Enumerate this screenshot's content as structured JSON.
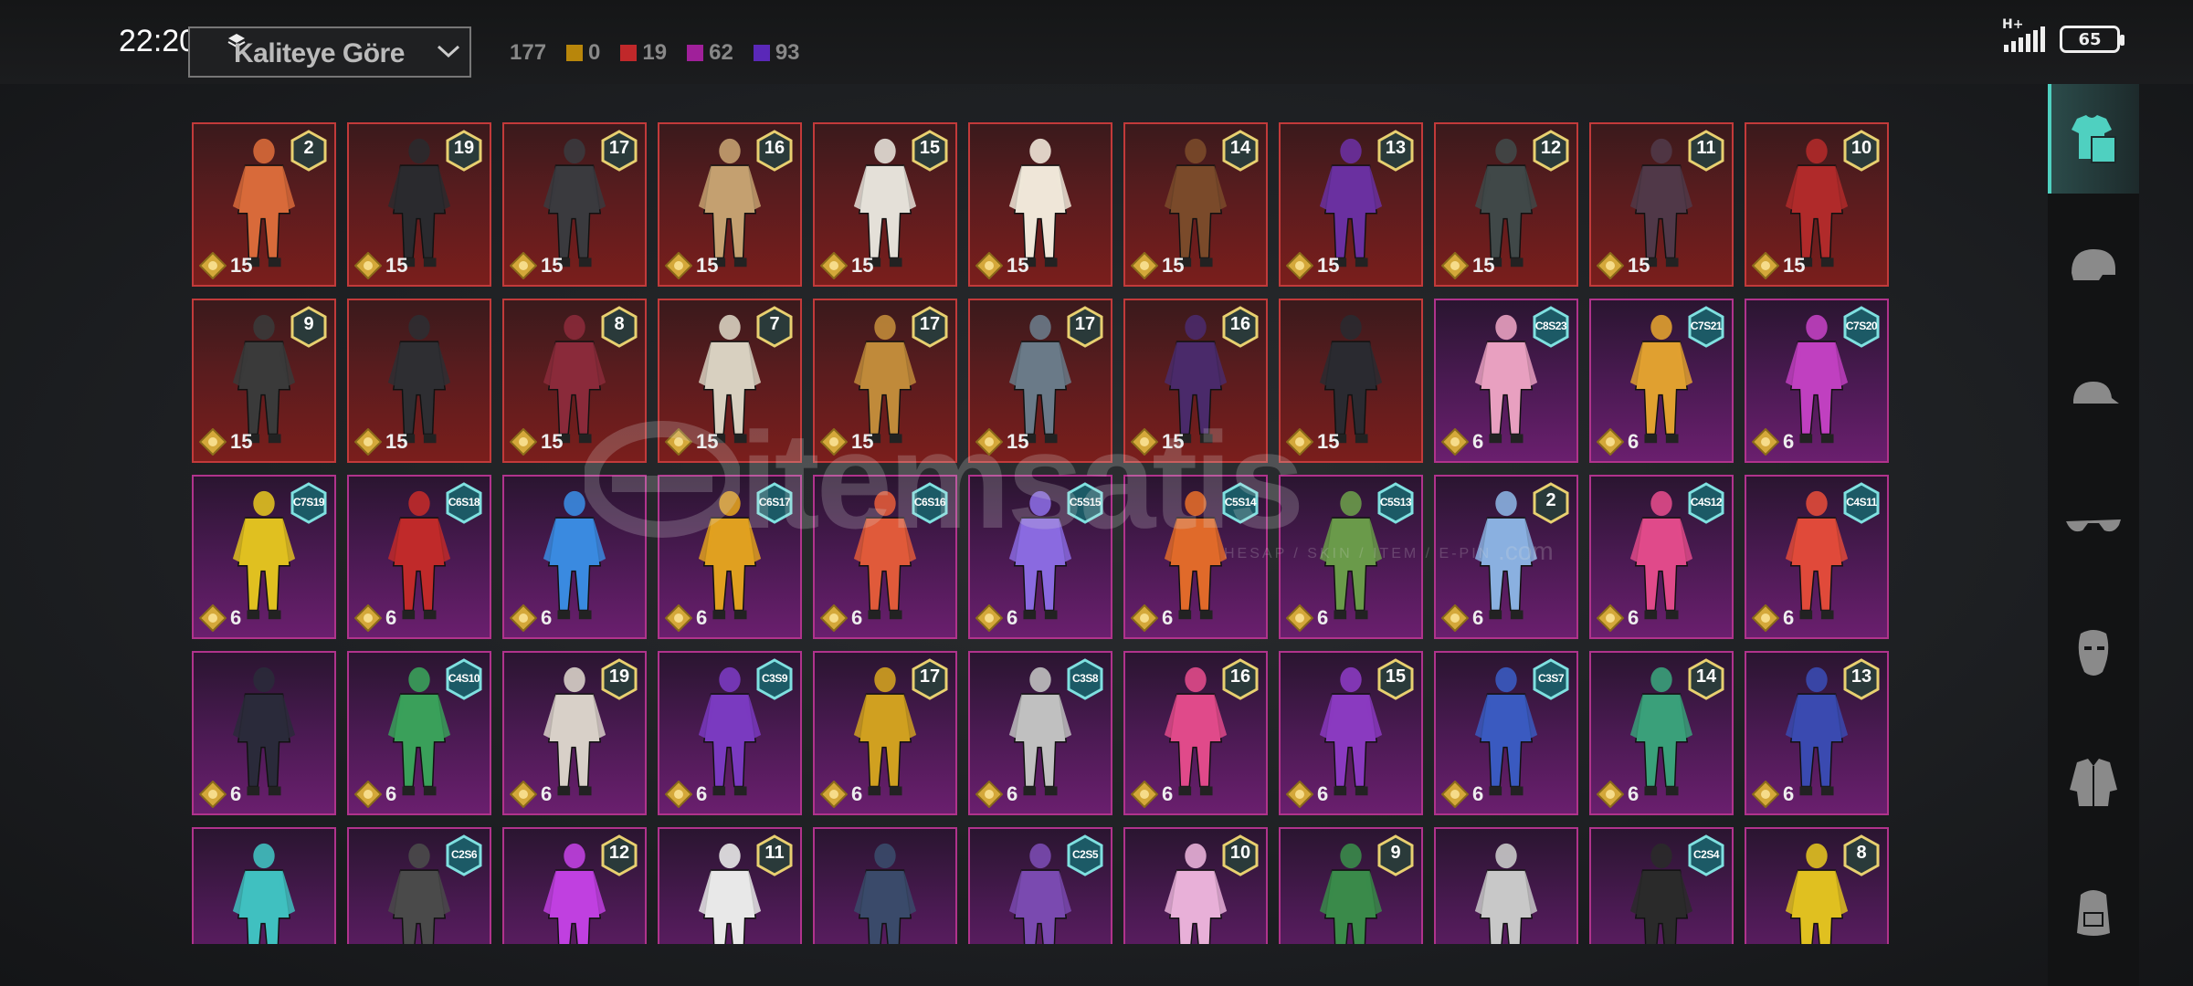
{
  "status_bar": {
    "time": "22:20",
    "network": "H+",
    "battery": "65"
  },
  "toolbar": {
    "sort_label": "Kaliteye Göre",
    "total_count": "177",
    "tier_counts": [
      {
        "value": "0",
        "color": "#b8860b"
      },
      {
        "value": "19",
        "color": "#c0282a"
      },
      {
        "value": "62",
        "color": "#a0209a"
      },
      {
        "value": "93",
        "color": "#5a28b8"
      }
    ]
  },
  "watermark": {
    "brand": "itemsatis",
    "tagline": "HESAP / SKIN / ITEM / E-PIN",
    "domain": ".com"
  },
  "categories": [
    {
      "icon": "outfit-icon",
      "active": true
    },
    {
      "icon": "helmet-icon",
      "active": false
    },
    {
      "icon": "cap-icon",
      "active": false
    },
    {
      "icon": "glasses-icon",
      "active": false
    },
    {
      "icon": "mask-icon",
      "active": false
    },
    {
      "icon": "jacket-icon",
      "active": false
    },
    {
      "icon": "backpack-icon",
      "active": false
    }
  ],
  "items": [
    {
      "tier": "red",
      "badge": "2",
      "price": "15",
      "color": "#d86a3a"
    },
    {
      "tier": "red",
      "badge": "19",
      "price": "15",
      "color": "#2a2a2e"
    },
    {
      "tier": "red",
      "badge": "17",
      "price": "15",
      "color": "#3a3a3e"
    },
    {
      "tier": "red",
      "badge": "16",
      "price": "15",
      "color": "#c4a070"
    },
    {
      "tier": "red",
      "badge": "15",
      "price": "15",
      "color": "#e4e0d8"
    },
    {
      "tier": "red",
      "badge": "",
      "price": "15",
      "color": "#efe6d8"
    },
    {
      "tier": "red",
      "badge": "14",
      "price": "15",
      "color": "#7a4a2a"
    },
    {
      "tier": "red",
      "badge": "13",
      "price": "15",
      "color": "#6a30a0"
    },
    {
      "tier": "red",
      "badge": "12",
      "price": "15",
      "color": "#404848"
    },
    {
      "tier": "red",
      "badge": "11",
      "price": "15",
      "color": "#503848"
    },
    {
      "tier": "red",
      "badge": "10",
      "price": "15",
      "color": "#b02a2a"
    },
    {
      "tier": "red",
      "badge": "9",
      "price": "15",
      "color": "#3a3a3a"
    },
    {
      "tier": "red",
      "badge": "",
      "price": "15",
      "color": "#2e2e32"
    },
    {
      "tier": "red",
      "badge": "8",
      "price": "15",
      "color": "#8a2a3a"
    },
    {
      "tier": "red",
      "badge": "7",
      "price": "15",
      "color": "#d8d0c0"
    },
    {
      "tier": "red",
      "badge": "17",
      "price": "15",
      "color": "#c08a3a"
    },
    {
      "tier": "red",
      "badge": "17",
      "price": "15",
      "color": "#6a7a88"
    },
    {
      "tier": "red",
      "badge": "16",
      "price": "15",
      "color": "#4a2a6a"
    },
    {
      "tier": "red",
      "badge": "",
      "price": "15",
      "color": "#2a2a30"
    },
    {
      "tier": "purple",
      "badge": "C8S23",
      "price": "6",
      "color": "#e8a0c0"
    },
    {
      "tier": "purple",
      "badge": "C7S21",
      "price": "6",
      "color": "#e0a030"
    },
    {
      "tier": "purple",
      "badge": "C7S20",
      "price": "6",
      "color": "#c040c0"
    },
    {
      "tier": "purple",
      "badge": "C7S19",
      "price": "6",
      "color": "#e0c020"
    },
    {
      "tier": "purple",
      "badge": "C6S18",
      "price": "6",
      "color": "#c02a2a"
    },
    {
      "tier": "purple",
      "badge": "",
      "price": "6",
      "color": "#3a8ae0"
    },
    {
      "tier": "purple",
      "badge": "C6S17",
      "price": "6",
      "color": "#e0a020"
    },
    {
      "tier": "purple",
      "badge": "C6S16",
      "price": "6",
      "color": "#e05a3a"
    },
    {
      "tier": "purple",
      "badge": "C5S15",
      "price": "6",
      "color": "#8a6ae0"
    },
    {
      "tier": "purple",
      "badge": "C5S14",
      "price": "6",
      "color": "#e06a2a"
    },
    {
      "tier": "purple",
      "badge": "C5S13",
      "price": "6",
      "color": "#6a9a4a"
    },
    {
      "tier": "purple",
      "badge": "2",
      "price": "6",
      "color": "#8ab0e0"
    },
    {
      "tier": "purple",
      "badge": "C4S12",
      "price": "6",
      "color": "#e04a8a"
    },
    {
      "tier": "purple",
      "badge": "C4S11",
      "price": "6",
      "color": "#e04a3a"
    },
    {
      "tier": "purple",
      "badge": "",
      "price": "6",
      "color": "#2a2a3a"
    },
    {
      "tier": "purple",
      "badge": "C4S10",
      "price": "6",
      "color": "#3aa05a"
    },
    {
      "tier": "purple",
      "badge": "19",
      "price": "6",
      "color": "#d8d0c8"
    },
    {
      "tier": "purple",
      "badge": "C3S9",
      "price": "6",
      "color": "#7a3ac0"
    },
    {
      "tier": "purple",
      "badge": "17",
      "price": "6",
      "color": "#d0a020"
    },
    {
      "tier": "purple",
      "badge": "C3S8",
      "price": "6",
      "color": "#c0c0c0"
    },
    {
      "tier": "purple",
      "badge": "16",
      "price": "6",
      "color": "#e04a8a"
    },
    {
      "tier": "purple",
      "badge": "15",
      "price": "6",
      "color": "#8a3ac0"
    },
    {
      "tier": "purple",
      "badge": "C3S7",
      "price": "6",
      "color": "#3a5ac0"
    },
    {
      "tier": "purple",
      "badge": "14",
      "price": "6",
      "color": "#3aa07a"
    },
    {
      "tier": "purple",
      "badge": "13",
      "price": "6",
      "color": "#3a4ab0"
    },
    {
      "tier": "purple",
      "badge": "",
      "price": "",
      "color": "#40c0c0"
    },
    {
      "tier": "purple",
      "badge": "C2S6",
      "price": "",
      "color": "#4a4a4a"
    },
    {
      "tier": "purple",
      "badge": "12",
      "price": "",
      "color": "#c040e0"
    },
    {
      "tier": "purple",
      "badge": "11",
      "price": "",
      "color": "#e8e8e8"
    },
    {
      "tier": "purple",
      "badge": "",
      "price": "",
      "color": "#3a4a6a"
    },
    {
      "tier": "purple",
      "badge": "C2S5",
      "price": "",
      "color": "#7a4ab0"
    },
    {
      "tier": "purple",
      "badge": "10",
      "price": "",
      "color": "#e8b0d8"
    },
    {
      "tier": "purple",
      "badge": "9",
      "price": "",
      "color": "#3a8a4a"
    },
    {
      "tier": "purple",
      "badge": "",
      "price": "",
      "color": "#c8c8c8"
    },
    {
      "tier": "purple",
      "badge": "C2S4",
      "price": "",
      "color": "#2a2a2a"
    },
    {
      "tier": "purple",
      "badge": "8",
      "price": "",
      "color": "#e0c020"
    }
  ]
}
